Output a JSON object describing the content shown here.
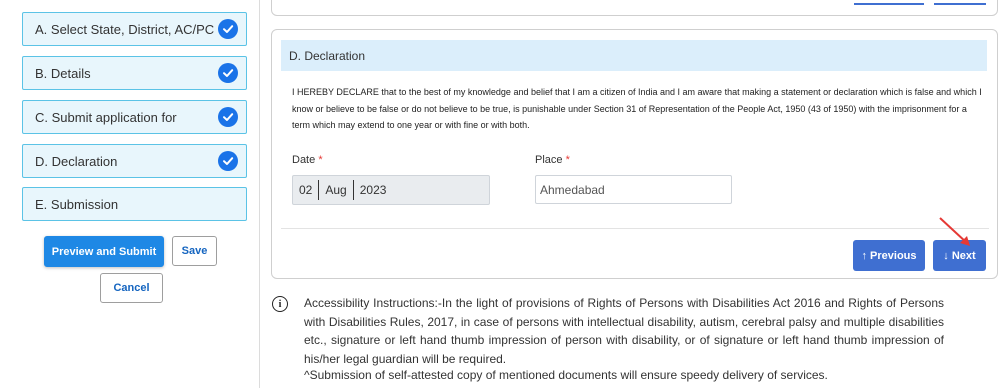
{
  "steps": [
    {
      "label": "A. Select State, District, AC/PC",
      "completed": true
    },
    {
      "label": "B. Details",
      "completed": true
    },
    {
      "label": "C. Submit application for",
      "completed": true
    },
    {
      "label": "D. Declaration",
      "completed": true
    },
    {
      "label": "E. Submission",
      "completed": false
    }
  ],
  "actions": {
    "preview_submit": "Preview and Submit",
    "save": "Save",
    "cancel": "Cancel"
  },
  "declaration": {
    "header": "D. Declaration",
    "text": "I HEREBY DECLARE that to the best of my knowledge and belief that I am a citizen of India and I am aware that making a statement or declaration which is false and which I know or believe to be false or do not believe to be true, is punishable under Section 31 of Representation of the People Act, 1950 (43 of 1950) with the imprisonment for a term which may extend to one year or with fine or with both.",
    "date_label": "Date",
    "date": {
      "day": "02",
      "month": "Aug",
      "year": "2023"
    },
    "place_label": "Place",
    "place_value": "Ahmedabad",
    "required_mark": "*"
  },
  "nav": {
    "previous": "↑ Previous",
    "next": "↓ Next"
  },
  "accessibility": {
    "text": "Accessibility Instructions:-In the light of provisions of Rights of Persons with Disabilities Act 2016 and Rights of Persons with Disabilities Rules, 2017, in case of persons with intellectual disability, autism, cerebral palsy and multiple disabilities etc., signature or left hand thumb impression of person with disability, or of signature or left hand thumb impression of his/her legal guardian will be required.",
    "note": "^Submission of self-attested copy of mentioned documents will ensure speedy delivery of services."
  },
  "colors": {
    "accent": "#3f6fd1",
    "step_bg": "#e8f6fc",
    "step_border": "#5bc3e6",
    "check": "#1a73e8",
    "required": "#e53935",
    "annotation_arrow": "#e53935"
  }
}
